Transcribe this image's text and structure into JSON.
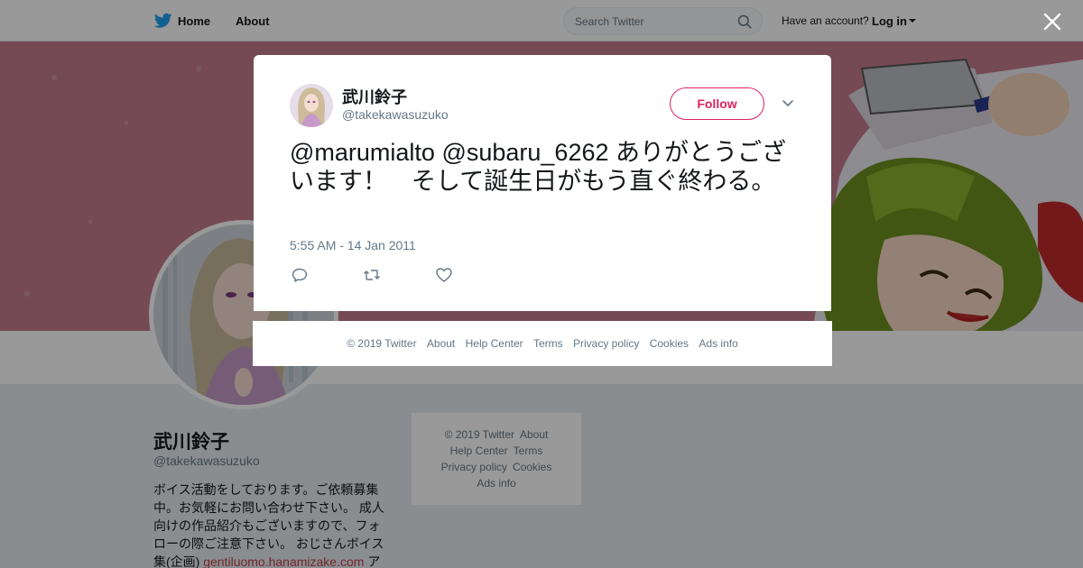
{
  "nav": {
    "home_label": "Home",
    "about_label": "About",
    "search_placeholder": "Search Twitter",
    "have_account": "Have an account?",
    "login_label": "Log in"
  },
  "profile": {
    "name": "武川鈴子",
    "handle": "@takekawasuzuko",
    "bio_text": "ボイス活動をしております。ご依頼募集中。お気軽にお問い合わせ下さい。 成人向けの作品紹介もございますので、フォローの際ご注意下さい。 おじさんボイス集(企画)",
    "bio_link": "gentiluomo.hanamizake.com",
    "bio_tail": " ア"
  },
  "tweet": {
    "author_name": "武川鈴子",
    "author_handle": "@takekawasuzuko",
    "follow_label": "Follow",
    "text": "@marumialto @subaru_6262 ありがとうございます！　そして誕生日がもう直ぐ終わる。",
    "timestamp": "5:55 AM - 14 Jan 2011"
  },
  "modal_footer": {
    "copyright": "© 2019 Twitter",
    "about": "About",
    "help": "Help Center",
    "terms": "Terms",
    "privacy": "Privacy policy",
    "cookies": "Cookies",
    "ads": "Ads info"
  },
  "side_footer": {
    "copyright": "© 2019 Twitter",
    "about": "About",
    "help": "Help Center",
    "terms": "Terms",
    "privacy": "Privacy policy",
    "cookies": "Cookies",
    "ads": "Ads info"
  },
  "colors": {
    "accent": "#e0245e",
    "banner": "#c57e8f",
    "link": "#c2424f",
    "twitter_blue": "#1da1f2"
  },
  "icons": [
    "twitter-bird-icon",
    "search-icon",
    "close-icon",
    "chevron-down-icon",
    "reply-icon",
    "retweet-icon",
    "like-icon"
  ]
}
